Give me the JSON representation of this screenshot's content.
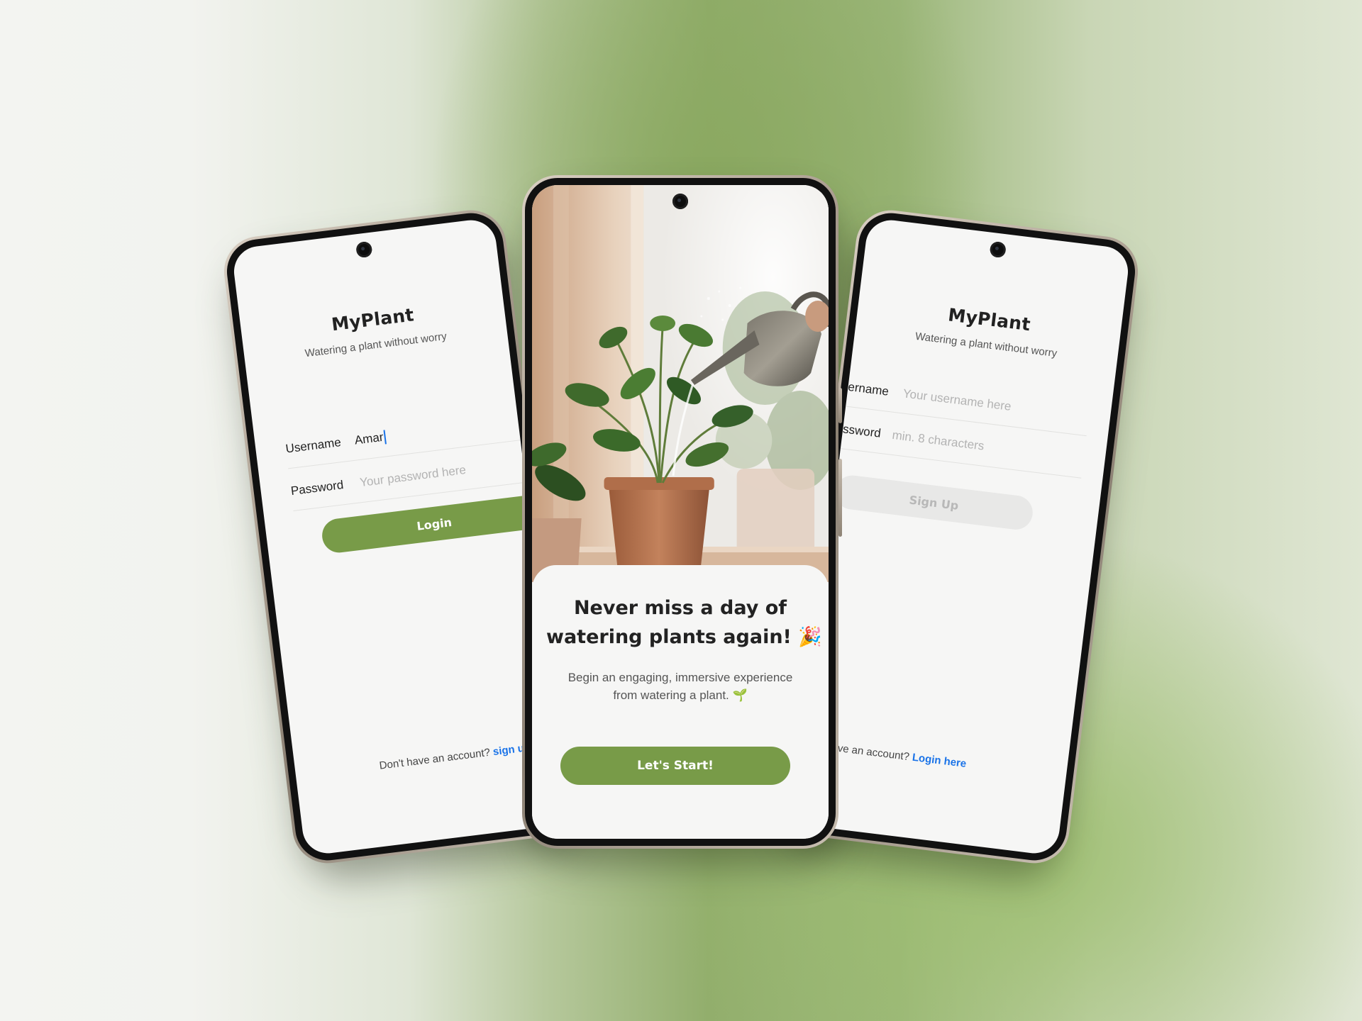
{
  "login_screen": {
    "app_title": "MyPlant",
    "tagline": "Watering a plant without worry",
    "username_label": "Username",
    "username_value": "Amar",
    "password_label": "Password",
    "password_placeholder": "Your password here",
    "login_button": "Login",
    "footer_text": "Don't have an account?",
    "footer_link": "sign up"
  },
  "welcome_screen": {
    "headline_line1": "Never miss a day of",
    "headline_line2": "watering plants again!",
    "headline_emoji": "🎉",
    "subtitle_line1": "Begin an engaging, immersive experience",
    "subtitle_line2": "from watering a plant.",
    "subtitle_emoji": "🌱",
    "start_button": "Let's Start!"
  },
  "signup_screen": {
    "app_title": "MyPlant",
    "tagline": "Watering a plant without worry",
    "username_label": "ername",
    "username_placeholder": "Your username here",
    "password_label": "ssword",
    "password_placeholder": "min. 8 characters",
    "signup_button": "Sign Up",
    "footer_text": "ady Have an account?",
    "footer_link": "Login here"
  },
  "colors": {
    "primary_green": "#789b48",
    "link_blue": "#1a73e8",
    "screen_bg": "#f6f6f5",
    "disabled_button": "#e8e8e7"
  }
}
